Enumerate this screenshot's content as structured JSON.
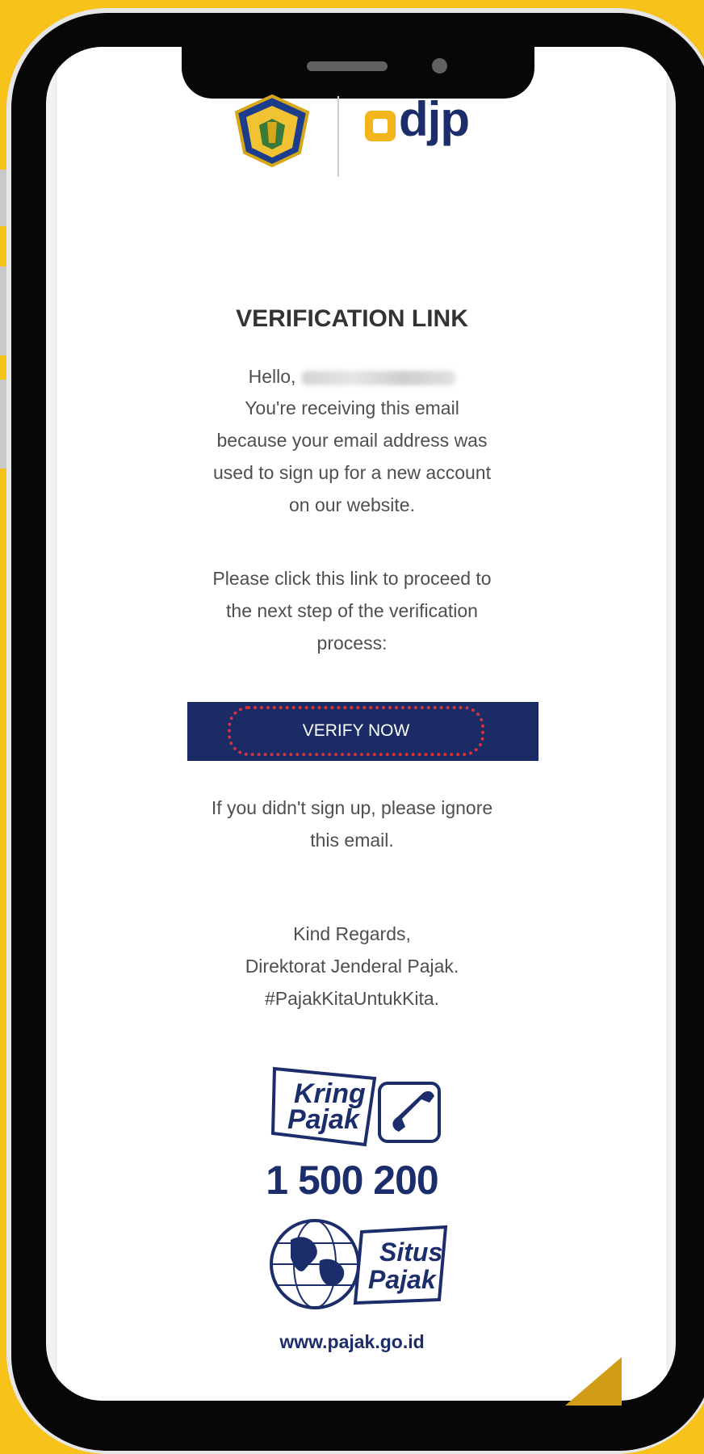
{
  "email": {
    "title": "VERIFICATION LINK",
    "greeting": "Hello,",
    "intro_lines": [
      "You're receiving this email",
      "because your email address was",
      "used to sign up for a new account",
      "on our website."
    ],
    "proceed_lines": [
      "Please click this link to proceed to",
      "the next step of the verification",
      "process:"
    ],
    "verify_button_label": "VERIFY NOW",
    "ignore_lines": [
      "If you didn't sign up, please ignore",
      "this email."
    ],
    "regards_lines": [
      "Kind Regards,",
      "Direktorat Jenderal Pajak.",
      "#PajakKitaUntukKita."
    ]
  },
  "branding": {
    "djp_logo_text": "djp",
    "kring_pajak_line1": "Kring",
    "kring_pajak_line2": "Pajak",
    "hotline_number": "1 500 200",
    "situs_pajak_line1": "Situs",
    "situs_pajak_line2": "Pajak",
    "website_url": "www.pajak.go.id"
  },
  "colors": {
    "background": "#f7c21a",
    "brand_navy": "#1c2d6b",
    "button_background": "#1a2b66",
    "highlight_dotted_border": "#d9323a",
    "djp_accent": "#f4b51a"
  }
}
